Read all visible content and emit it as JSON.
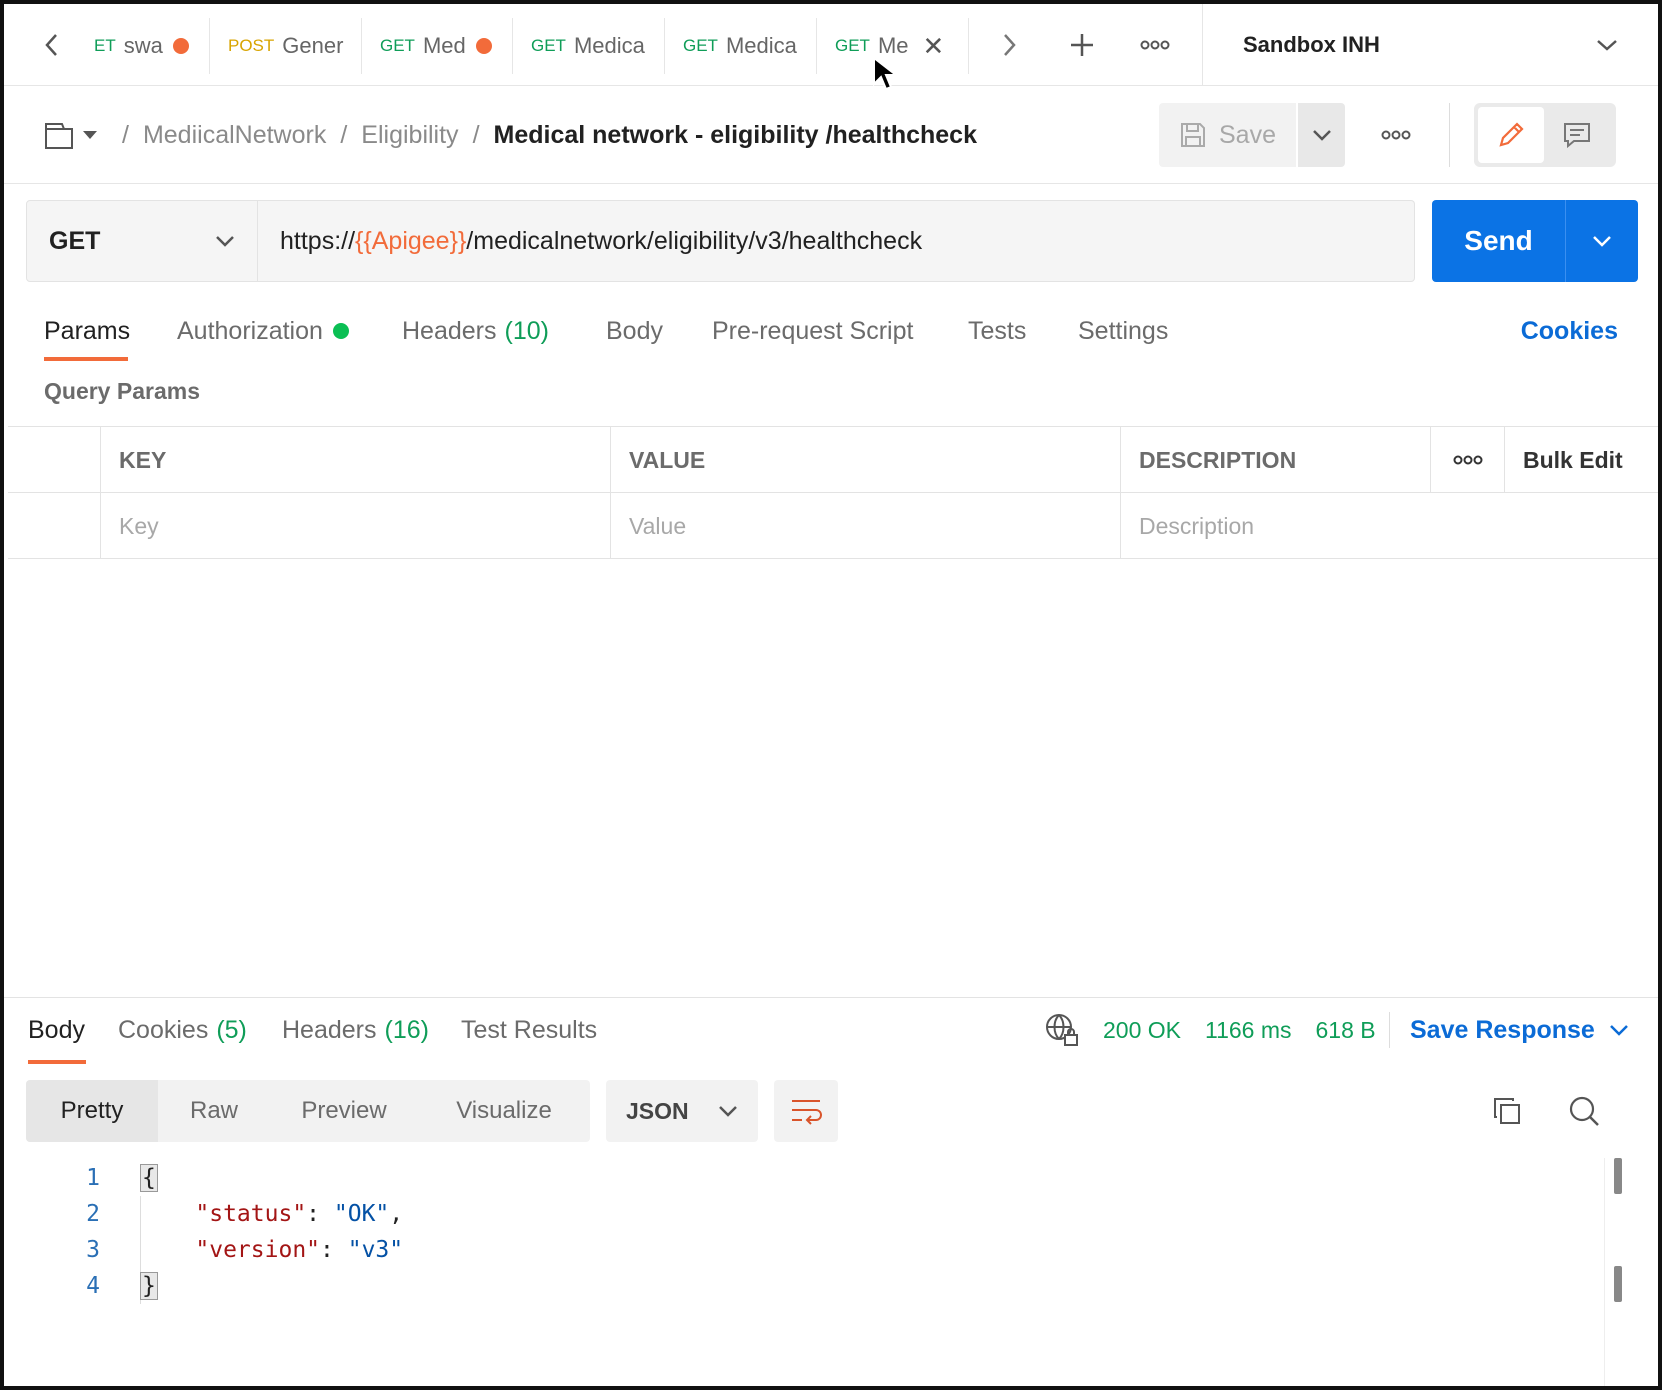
{
  "tabs": [
    {
      "method": "ET",
      "name": "swa",
      "dirty": true
    },
    {
      "method": "POST",
      "name": "Gener",
      "dirty": false
    },
    {
      "method": "GET",
      "name": "Med",
      "dirty": true
    },
    {
      "method": "GET",
      "name": "Medica",
      "dirty": false
    },
    {
      "method": "GET",
      "name": "Medica",
      "dirty": false
    },
    {
      "method": "GET",
      "name": "Me",
      "dirty": false,
      "active": true
    }
  ],
  "environment": "Sandbox INH",
  "breadcrumb": {
    "items": [
      "MediicalNetwork",
      "Eligibility"
    ],
    "current": "Medical network - eligibility /healthcheck"
  },
  "save_label": "Save",
  "request": {
    "method": "GET",
    "url_prefix": "https://",
    "url_variable": "{{Apigee}}",
    "url_suffix": "/medicalnetwork/eligibility/v3/healthcheck",
    "send_label": "Send"
  },
  "request_tabs": {
    "params": "Params",
    "authorization": "Authorization",
    "headers": "Headers",
    "headers_count": "(10)",
    "body": "Body",
    "prerequest": "Pre-request Script",
    "tests": "Tests",
    "settings": "Settings",
    "cookies": "Cookies"
  },
  "query_params": {
    "label": "Query Params",
    "headers": {
      "key": "KEY",
      "value": "VALUE",
      "description": "DESCRIPTION",
      "bulk_edit": "Bulk Edit"
    },
    "placeholders": {
      "key": "Key",
      "value": "Value",
      "description": "Description"
    }
  },
  "response": {
    "tabs": {
      "body": "Body",
      "cookies": "Cookies",
      "cookies_count": "(5)",
      "headers": "Headers",
      "headers_count": "(16)",
      "test_results": "Test Results"
    },
    "status": "200 OK",
    "time": "1166 ms",
    "size": "618 B",
    "save_response": "Save Response",
    "views": [
      "Pretty",
      "Raw",
      "Preview",
      "Visualize"
    ],
    "format": "JSON",
    "lines": [
      {
        "num": "1",
        "text": "{"
      },
      {
        "num": "2",
        "key": "\"status\"",
        "value": "\"OK\"",
        "trail": ","
      },
      {
        "num": "3",
        "key": "\"version\"",
        "value": "\"v3\"",
        "trail": ""
      },
      {
        "num": "4",
        "text": "}"
      }
    ]
  },
  "colors": {
    "accent": "#f26b3a",
    "send": "#0b73e5",
    "success": "#0f9d58",
    "link": "#0b6bd6"
  }
}
